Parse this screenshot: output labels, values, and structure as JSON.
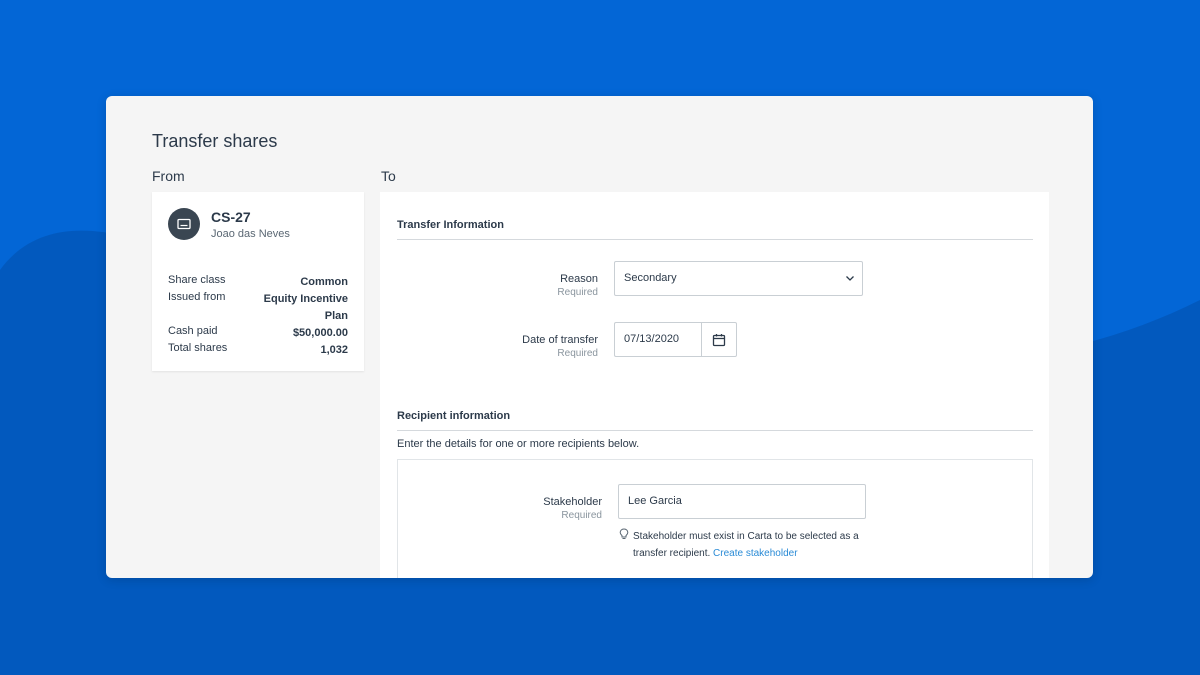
{
  "page": {
    "title": "Transfer shares",
    "from_label": "From",
    "to_label": "To"
  },
  "colors": {
    "background": "#0366d6",
    "background_dark": "#0259be",
    "card": "#f5f5f5",
    "panel": "#ffffff",
    "text": "#2c3a4a",
    "link": "#2a8bd6",
    "avatar": "#3a4652"
  },
  "from_card": {
    "icon": "certificate-icon",
    "certificate_id": "CS-27",
    "holder": "Joao das Neves",
    "details": [
      {
        "label": "Share class",
        "value": "Common"
      },
      {
        "label": "Issued from",
        "value": "Equity Incentive Plan"
      },
      {
        "label": "Cash paid",
        "value": "$50,000.00"
      },
      {
        "label": "Total shares",
        "value": "1,032"
      }
    ]
  },
  "transfer_info": {
    "title": "Transfer Information",
    "reason": {
      "label": "Reason",
      "required": "Required",
      "value": "Secondary",
      "icon": "chevron-down-icon"
    },
    "date": {
      "label": "Date of transfer",
      "required": "Required",
      "value": "07/13/2020",
      "icon": "calendar-icon"
    }
  },
  "recipient_info": {
    "title": "Recipient information",
    "help": "Enter the details for one or more recipients below.",
    "stakeholder": {
      "label": "Stakeholder",
      "required": "Required",
      "value": "Lee Garcia"
    },
    "hint_icon": "lightbulb-icon",
    "hint_text": "Stakeholder must exist in Carta to be selected as a transfer recipient.",
    "hint_link": "Create stakeholder"
  }
}
